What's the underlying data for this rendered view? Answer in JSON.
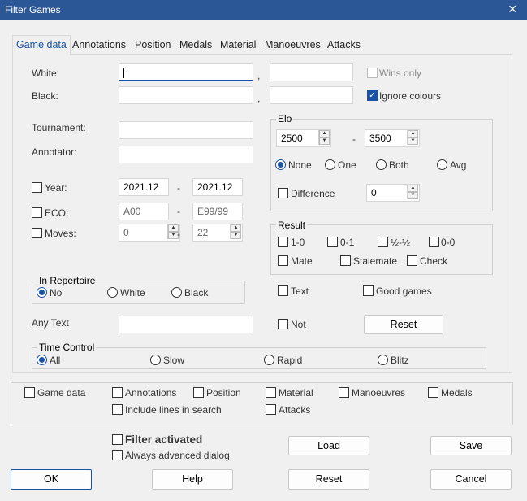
{
  "window": {
    "title": "Filter Games",
    "close": "✕"
  },
  "tabs": [
    "Game data",
    "Annotations",
    "Position",
    "Medals",
    "Material",
    "Manoeuvres",
    "Attacks"
  ],
  "players": {
    "white_label": "White:",
    "black_label": "Black:",
    "white_value": "",
    "black_value": "",
    "white_sep": ",",
    "black_sep": ",",
    "wins_only": "Wins only",
    "ignore_colours": "Ignore colours"
  },
  "tournament_label": "Tournament:",
  "annotator_label": "Annotator:",
  "elo": {
    "title": "Elo",
    "from": "2500",
    "to": "3500",
    "dash": "-",
    "options": [
      "None",
      "One",
      "Both",
      "Avg"
    ],
    "difference_label": "Difference",
    "difference_value": "0"
  },
  "year": {
    "label": "Year:",
    "from": "2021.12",
    "to": "2021.12",
    "dash": "-"
  },
  "eco": {
    "label": "ECO:",
    "from": "A00",
    "to": "E99/99",
    "dash": "-"
  },
  "moves": {
    "label": "Moves:",
    "from": "0",
    "to": "22",
    "dash": "-"
  },
  "result": {
    "title": "Result",
    "options": [
      "1-0",
      "0-1",
      "½-½",
      "0-0",
      "Mate",
      "Stalemate",
      "Check"
    ]
  },
  "repertoire": {
    "title": "In Repertoire",
    "options": [
      "No",
      "White",
      "Black"
    ]
  },
  "text_label": "Text",
  "good_games_label": "Good games",
  "any_text_label": "Any Text",
  "not_label": "Not",
  "reset_inner": "Reset",
  "time_control": {
    "title": "Time Control",
    "options": [
      "All",
      "Slow",
      "Rapid",
      "Blitz"
    ]
  },
  "bottom_filters": [
    "Game data",
    "Annotations",
    "Position",
    "Material",
    "Manoeuvres",
    "Medals",
    "Include lines in search",
    "Attacks"
  ],
  "filter_activated": "Filter activated",
  "always_advanced": "Always advanced dialog",
  "buttons": {
    "load": "Load",
    "save": "Save",
    "ok": "OK",
    "help": "Help",
    "reset": "Reset",
    "cancel": "Cancel"
  },
  "spin_up": "▲",
  "spin_down": "▼",
  "check_mark": "✓",
  "colors": {
    "accent": "#1a53a6",
    "titlebar": "#2b5797"
  }
}
